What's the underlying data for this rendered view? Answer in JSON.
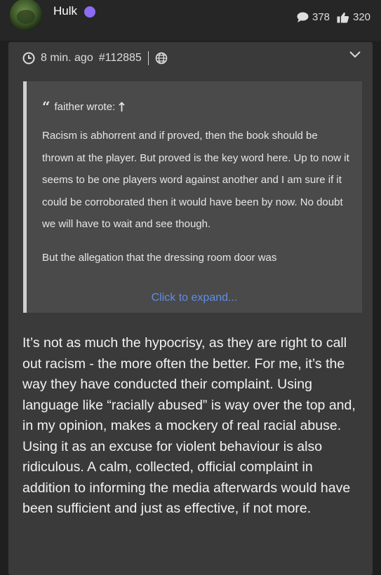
{
  "user": {
    "name": "Hulk",
    "avatar_icon": "hulk-avatar",
    "status_color": "#8c6cf3"
  },
  "stats": {
    "replies": "378",
    "likes": "320"
  },
  "post": {
    "time": "8 min. ago",
    "id": "#112885"
  },
  "quote": {
    "header": "faither wrote:",
    "paragraphs": [
      "Racism is abhorrent and if proved, then the book should be thrown at the player. But proved is the key word here. Up to now it seems to be one players word against another and I am sure if it could be corroborated then it would have been by now. No doubt we will have to wait and see though.",
      "But the allegation that the dressing room door was"
    ],
    "expand_label": "Click to expand..."
  },
  "reply": {
    "text": "It’s not as much the hypocrisy, as they are right to call out racism - the more often the better. For me, it’s the way they have conducted their complaint. Using language like “racially abused” is way over the top and, in my opinion, makes a mockery of real racial abuse. Using it as an excuse for violent behaviour is also ridiculous. A calm, collected, official complaint in addition to informing the media afterwards would have been sufficient and just as effective, if not more."
  },
  "colors": {
    "accent_link": "#5e8ee6",
    "background": "#1f1f1f",
    "card": "#3a3a3a",
    "quote": "#4a4a4a"
  }
}
